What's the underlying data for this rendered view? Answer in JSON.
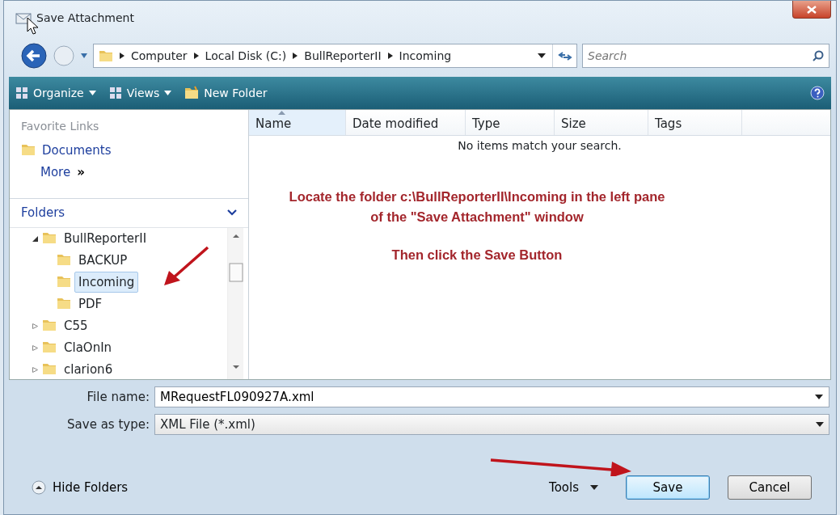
{
  "window": {
    "title": "Save Attachment"
  },
  "address_bar": {
    "breadcrumbs": [
      "Computer",
      "Local Disk (C:)",
      "BullReporterII",
      "Incoming"
    ]
  },
  "search": {
    "placeholder": "Search"
  },
  "toolbar": {
    "items": [
      {
        "label": "Organize",
        "kind": "menu"
      },
      {
        "label": "Views",
        "kind": "menu"
      },
      {
        "label": "New Folder",
        "kind": "folder"
      }
    ]
  },
  "favorite_links": {
    "heading": "Favorite Links",
    "items": [
      "Documents"
    ],
    "more": "More",
    "more_glyph": "»"
  },
  "folders": {
    "heading": "Folders",
    "items": [
      {
        "label": "BullReporterII",
        "expanded": true,
        "selected": false,
        "children": [
          {
            "label": "BACKUP",
            "selected": false
          },
          {
            "label": "Incoming",
            "selected": true
          },
          {
            "label": "PDF",
            "selected": false
          }
        ]
      },
      {
        "label": "C55",
        "expanded": false,
        "selected": false
      },
      {
        "label": "ClaOnIn",
        "expanded": false,
        "selected": false
      },
      {
        "label": "clarion6",
        "expanded": false,
        "selected": false
      }
    ]
  },
  "file_list": {
    "columns": [
      {
        "label": "Name",
        "sorted": true
      },
      {
        "label": "Date modified",
        "sorted": false
      },
      {
        "label": "Type",
        "sorted": false
      },
      {
        "label": "Size",
        "sorted": false
      },
      {
        "label": "Tags",
        "sorted": false
      }
    ],
    "empty_message": "No items match your search."
  },
  "instructions": [
    "Locate the folder c:\\BullReporterII\\Incoming in the left pane of the \"Save Attachment\" window",
    "Then click the Save Button"
  ],
  "file_name": {
    "label": "File name:",
    "value": "MRequestFL090927A.xml"
  },
  "save_as_type": {
    "label": "Save as type:",
    "value": "XML File (*.xml)"
  },
  "hide_folders": "Hide Folders",
  "tools": "Tools",
  "buttons": [
    {
      "label": "Save",
      "default": true
    },
    {
      "label": "Cancel",
      "default": false
    }
  ]
}
